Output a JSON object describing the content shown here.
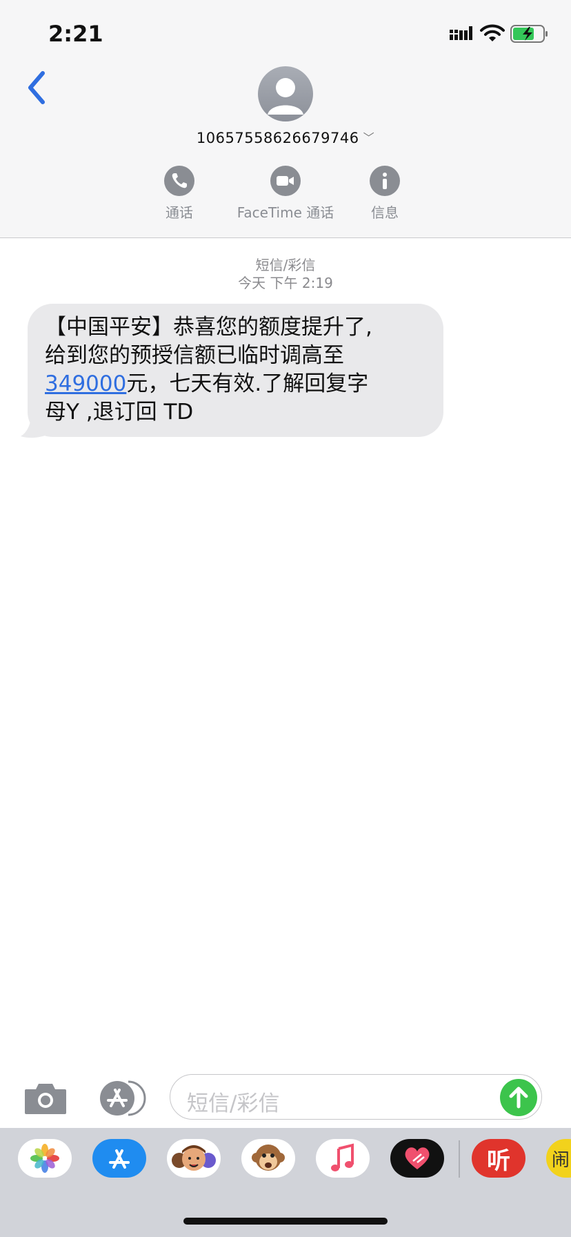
{
  "status_bar": {
    "time": "2:21"
  },
  "header": {
    "contact_number": "10657558626679746",
    "actions": [
      {
        "label": "通话",
        "icon": "phone-icon"
      },
      {
        "label": "FaceTime 通话",
        "icon": "video-camera-icon"
      },
      {
        "label": "信息",
        "icon": "info-icon"
      }
    ]
  },
  "conversation": {
    "type_label": "短信/彩信",
    "timestamp": "今天 下午 2:19",
    "message": {
      "line1": "【中国平安】恭喜您的额度提升了,",
      "line2": "给到您的预授信额已临时调高至",
      "link": "349000",
      "line3_rest": "元，七天有效.了解回复字",
      "line4": "母Y ,退订回 TD"
    }
  },
  "input": {
    "placeholder": "短信/彩信"
  },
  "app_drawer": {
    "apps": [
      "photos-app-icon",
      "app-store-icon",
      "memoji-icon",
      "animoji-monkey-icon",
      "music-app-icon",
      "heart-app-icon",
      "ting-app-icon",
      "partial-app-icon"
    ],
    "ting_label": "听",
    "partial_label": "闹"
  },
  "colors": {
    "accent_blue": "#2f6ee0",
    "send_green": "#3cc44c",
    "bubble_gray": "#e9e9eb",
    "header_bg": "#f6f6f7"
  }
}
